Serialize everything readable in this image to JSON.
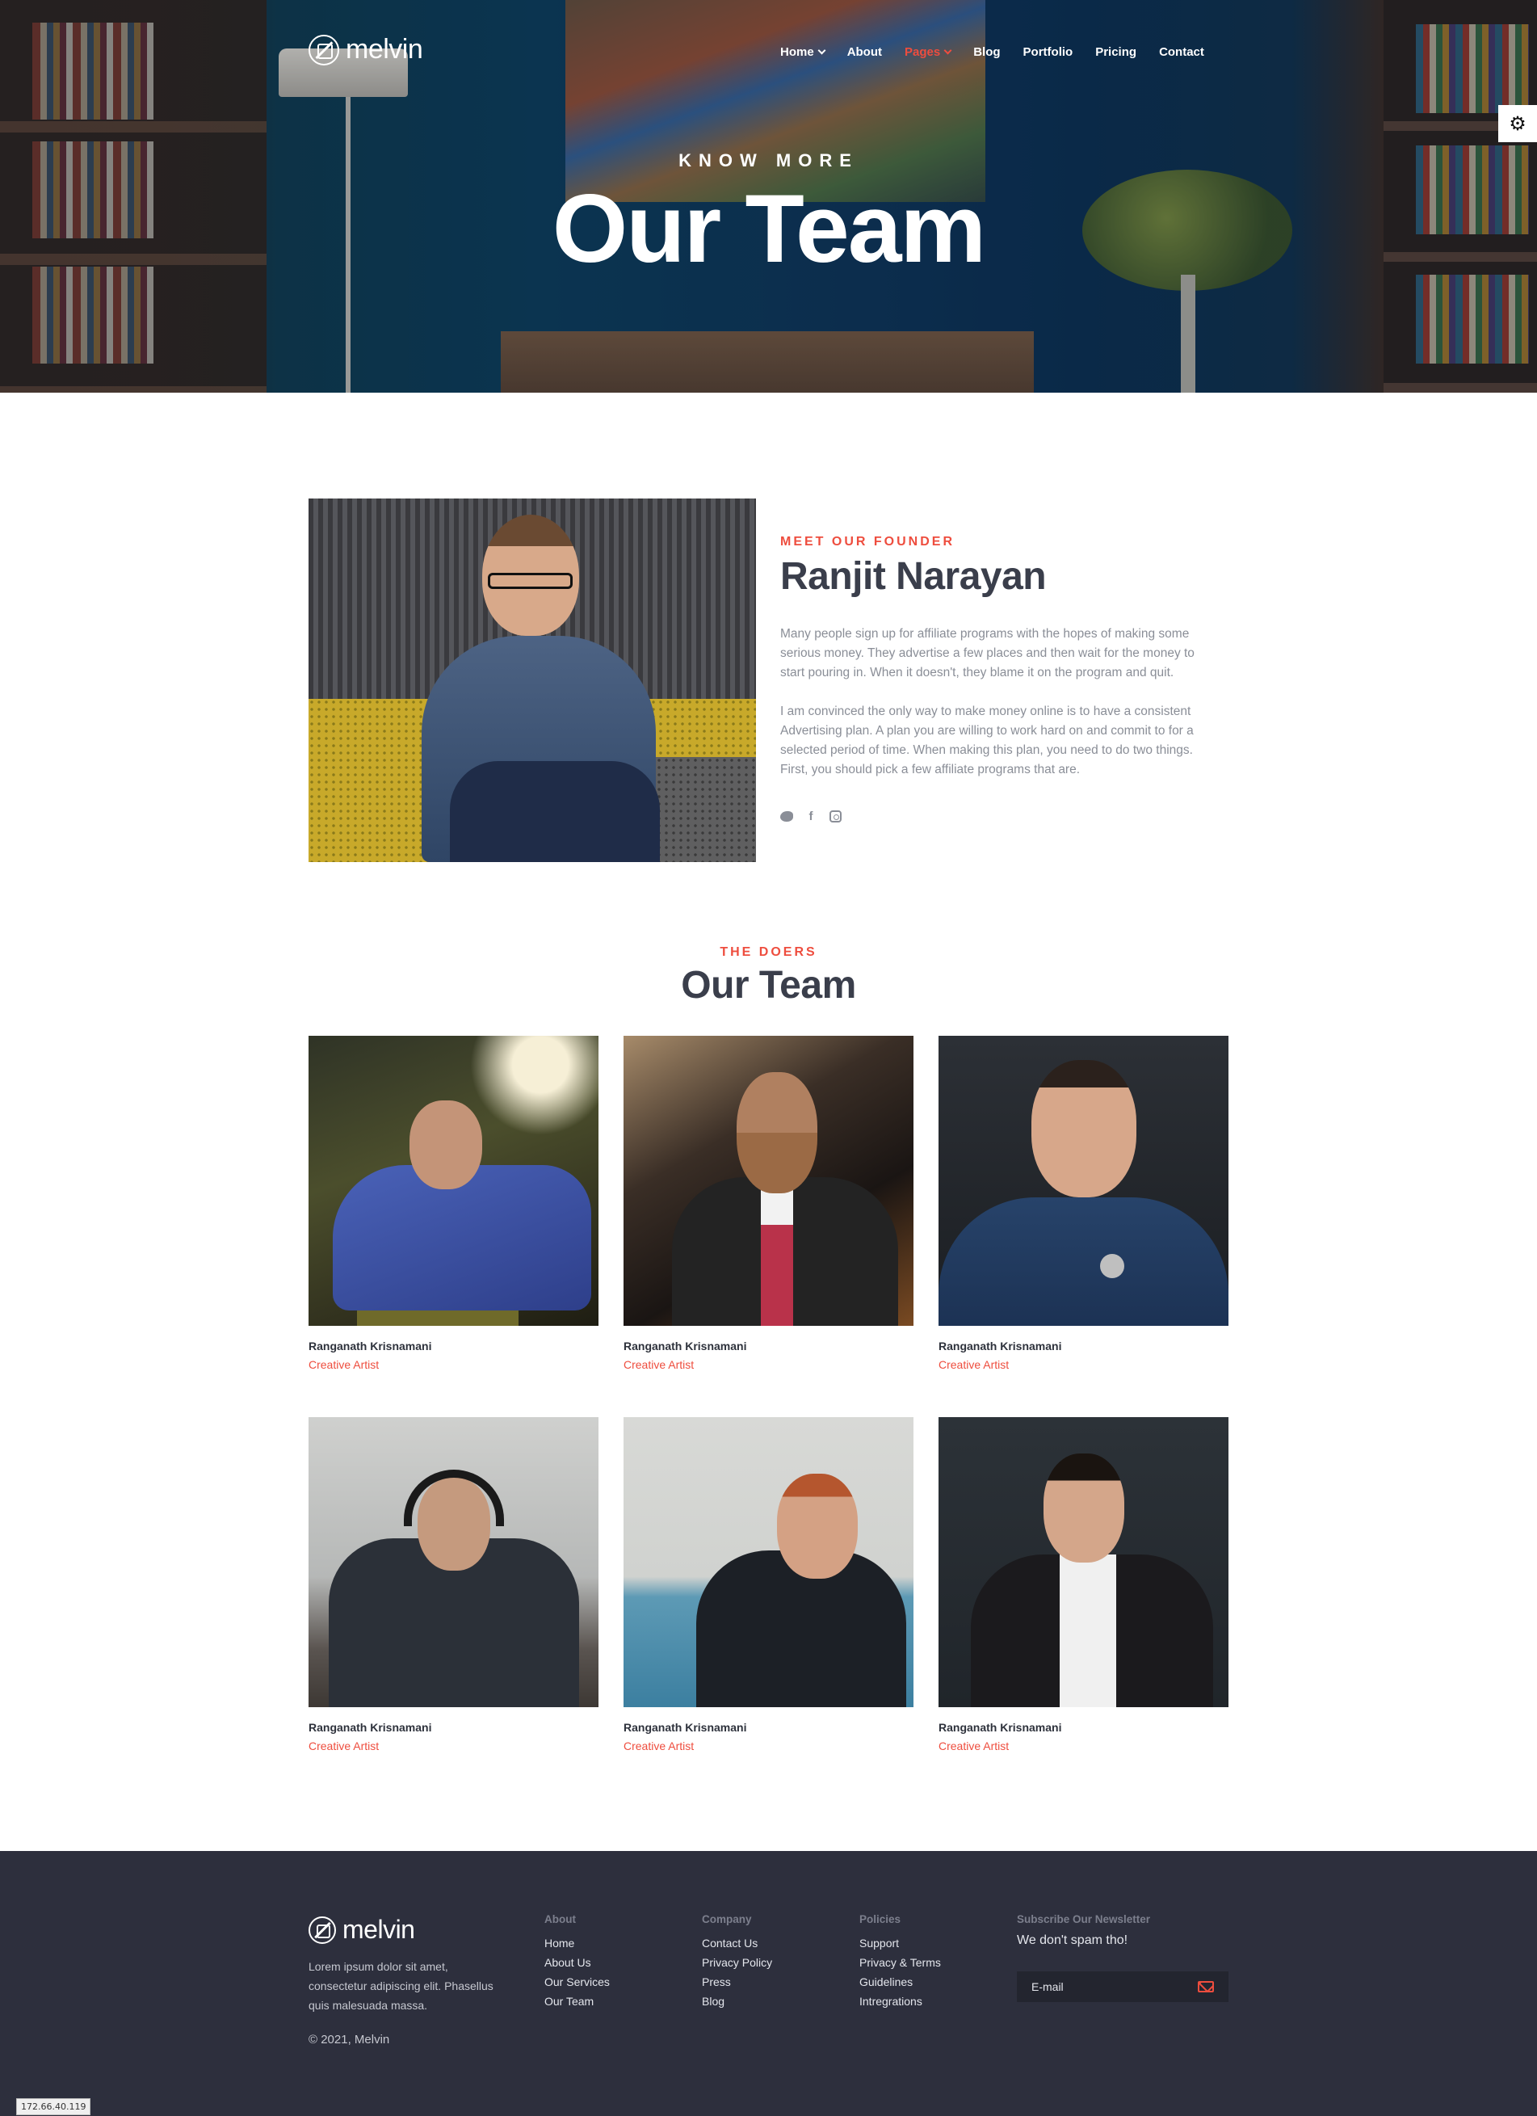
{
  "brand": {
    "name": "melvin"
  },
  "nav": {
    "items": [
      {
        "label": "Home",
        "has_dropdown": true,
        "active": false
      },
      {
        "label": "About",
        "has_dropdown": false,
        "active": false
      },
      {
        "label": "Pages",
        "has_dropdown": true,
        "active": true
      },
      {
        "label": "Blog",
        "has_dropdown": false,
        "active": false
      },
      {
        "label": "Portfolio",
        "has_dropdown": false,
        "active": false
      },
      {
        "label": "Pricing",
        "has_dropdown": false,
        "active": false
      },
      {
        "label": "Contact",
        "has_dropdown": false,
        "active": false
      }
    ]
  },
  "hero": {
    "kicker": "KNOW MORE",
    "title": "Our Team"
  },
  "founder": {
    "kicker": "MEET OUR FOUNDER",
    "name": "Ranjit Narayan",
    "paragraphs": [
      "Many people sign up for affiliate programs with the hopes of making some serious money. They advertise a few places and then wait for the money to start pouring in. When it doesn't, they blame it on the program and quit.",
      "I am convinced the only way to make money online is to have a consistent Advertising plan. A plan you are willing to work hard on and commit to for a selected period of time. When making this plan, you need to do two things. First, you should pick a few affiliate programs that are."
    ],
    "socials": [
      "twitter-icon",
      "facebook-icon",
      "instagram-icon"
    ]
  },
  "team": {
    "kicker": "THE DOERS",
    "title": "Our Team",
    "members": [
      {
        "name": "Ranganath Krisnamani",
        "role": "Creative Artist"
      },
      {
        "name": "Ranganath Krisnamani",
        "role": "Creative Artist"
      },
      {
        "name": "Ranganath Krisnamani",
        "role": "Creative Artist"
      },
      {
        "name": "Ranganath Krisnamani",
        "role": "Creative Artist"
      },
      {
        "name": "Ranganath Krisnamani",
        "role": "Creative Artist"
      },
      {
        "name": "Ranganath Krisnamani",
        "role": "Creative Artist"
      }
    ]
  },
  "footer": {
    "about": "Lorem ipsum dolor sit amet, consectetur adipiscing elit. Phasellus quis malesuada massa.",
    "copyright": "© 2021, Melvin",
    "columns": [
      {
        "heading": "About",
        "links": [
          "Home",
          "About Us",
          "Our Services",
          "Our Team"
        ]
      },
      {
        "heading": "Company",
        "links": [
          "Contact Us",
          "Privacy Policy",
          "Press",
          "Blog"
        ]
      },
      {
        "heading": "Policies",
        "links": [
          "Support",
          "Privacy & Terms",
          "Guidelines",
          "Intregrations"
        ]
      }
    ],
    "newsletter": {
      "heading": "Subscribe Our Newsletter",
      "tagline": "We don't spam tho!",
      "placeholder": "E-mail"
    }
  },
  "status_badge": "172.66.40.119",
  "colors": {
    "accent": "#ee4d3e",
    "footer_bg": "#2d2f3d",
    "heading": "#3a3e4b"
  }
}
